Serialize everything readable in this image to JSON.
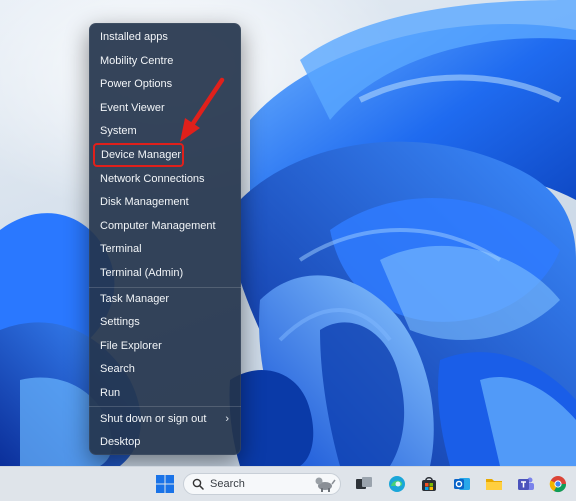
{
  "start_menu": {
    "items": [
      {
        "label": "Installed apps"
      },
      {
        "label": "Mobility Centre"
      },
      {
        "label": "Power Options"
      },
      {
        "label": "Event Viewer"
      },
      {
        "label": "System"
      },
      {
        "label": "Device Manager"
      },
      {
        "label": "Network Connections"
      },
      {
        "label": "Disk Management"
      },
      {
        "label": "Computer Management"
      },
      {
        "label": "Terminal"
      },
      {
        "label": "Terminal (Admin)"
      },
      {
        "label": "Task Manager"
      },
      {
        "label": "Settings"
      },
      {
        "label": "File Explorer"
      },
      {
        "label": "Search"
      },
      {
        "label": "Run"
      },
      {
        "label": "Shut down or sign out"
      },
      {
        "label": "Desktop"
      }
    ],
    "highlighted_item": "Device Manager",
    "highlight_color": "#e0201b"
  },
  "taskbar": {
    "search_placeholder": "Search",
    "apps": [
      "start-icon",
      "search-icon",
      "task-view-icon",
      "edge-icon",
      "store-icon",
      "outlook-icon",
      "file-explorer-icon",
      "teams-icon",
      "chrome-icon"
    ]
  },
  "colors": {
    "menu_bg": "#24344c",
    "annotation": "#e0201b"
  }
}
